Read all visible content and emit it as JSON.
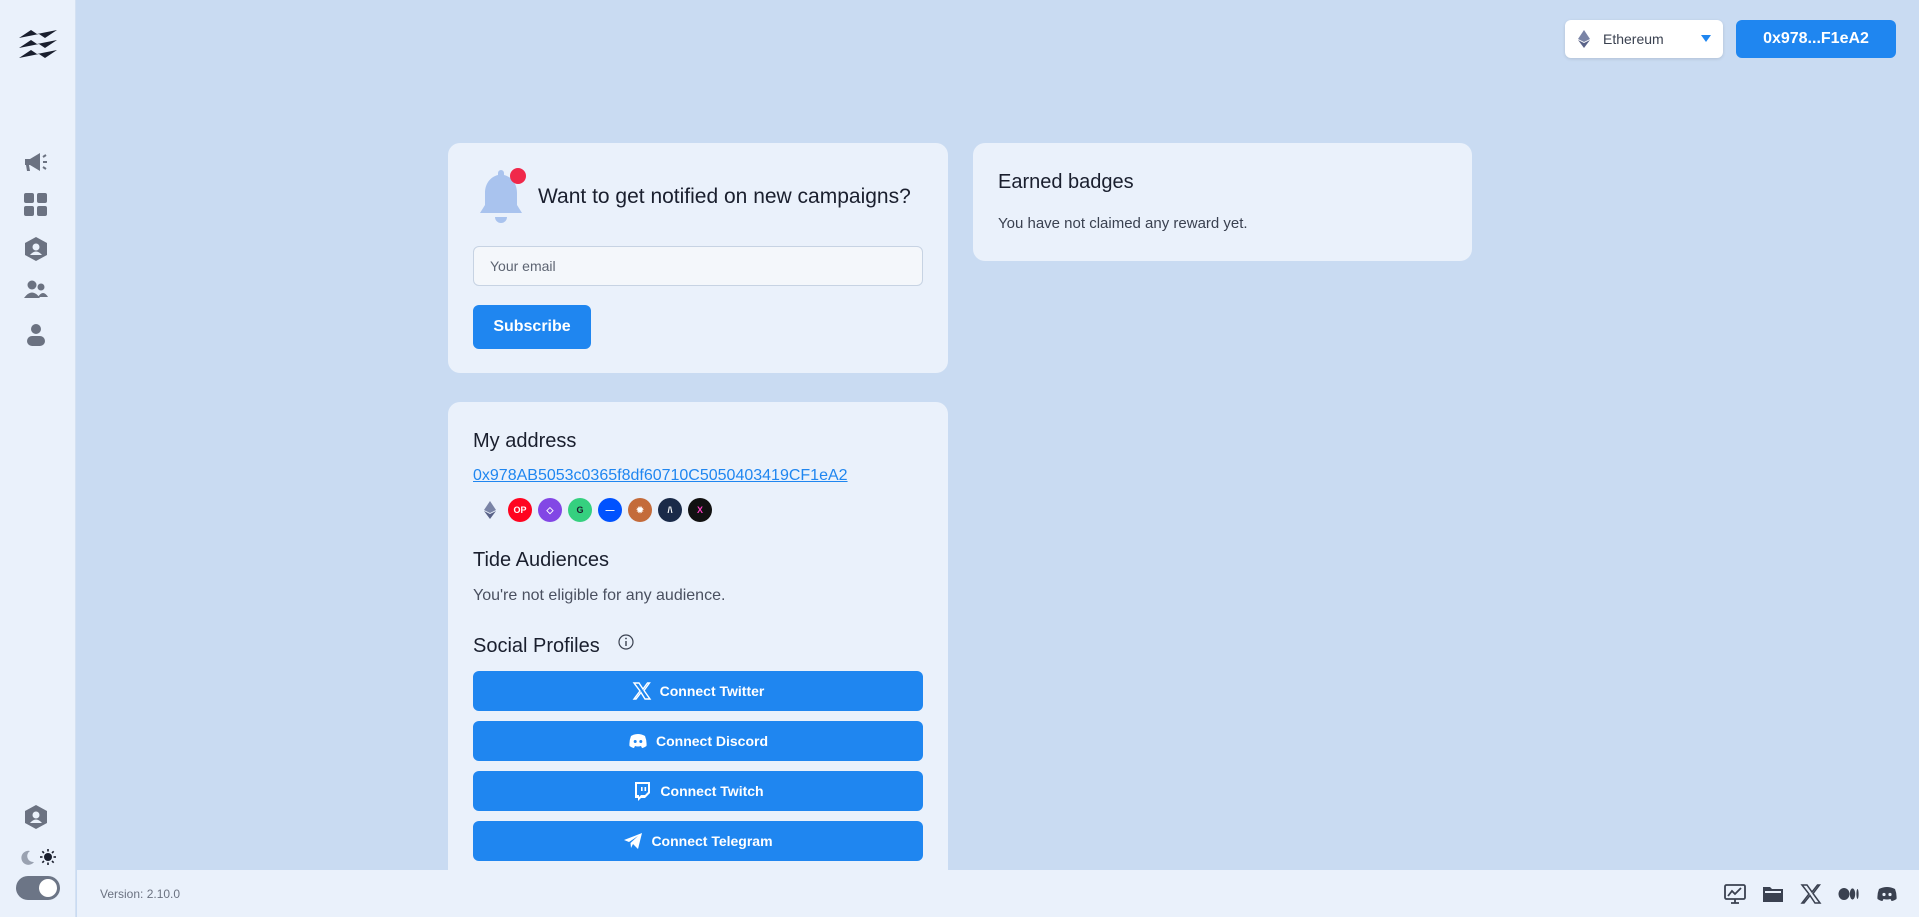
{
  "sidebar": {
    "logo": "tide-logo-icon",
    "items": [
      {
        "icon": "megaphone-icon",
        "name": "campaigns"
      },
      {
        "icon": "grid-icon",
        "name": "dashboard"
      },
      {
        "icon": "shield-user-icon",
        "name": "audiences"
      },
      {
        "icon": "users-icon",
        "name": "community"
      },
      {
        "icon": "user-icon",
        "name": "profile"
      }
    ],
    "bottom_icon": "shield-user-icon",
    "theme_toggle": {
      "state": "light"
    }
  },
  "header": {
    "network": "Ethereum",
    "wallet_button": "0x978...F1eA2"
  },
  "notify": {
    "title": "Want to get notified on new campaigns?",
    "email_placeholder": "Your email",
    "email_value": "",
    "subscribe_label": "Subscribe"
  },
  "badges": {
    "title": "Earned badges",
    "empty_text": "You have not claimed any reward yet."
  },
  "address": {
    "title": "My address",
    "full_address": "0x978AB5053c0365f8df60710C5050403419CF1eA2",
    "chains": [
      "ethereum",
      "optimism",
      "polygon",
      "celo",
      "base",
      "arbitrum-alt",
      "immutable",
      "linea"
    ],
    "audiences_title": "Tide Audiences",
    "audiences_text": "You're not eligible for any audience.",
    "social_title": "Social Profiles",
    "social_buttons": [
      {
        "label": "Connect Twitter",
        "icon": "x-twitter-icon"
      },
      {
        "label": "Connect Discord",
        "icon": "discord-icon"
      },
      {
        "label": "Connect Twitch",
        "icon": "twitch-icon"
      },
      {
        "label": "Connect Telegram",
        "icon": "telegram-icon"
      }
    ]
  },
  "footer": {
    "version": "Version: 2.10.0",
    "icons": [
      "analytics-icon",
      "folder-icon",
      "x-twitter-icon",
      "medium-icon",
      "discord-icon"
    ]
  },
  "colors": {
    "background": "#c9dbf2",
    "card": "#eaf1fb",
    "accent": "#1f86f0",
    "notification_dot": "#f0284a"
  }
}
